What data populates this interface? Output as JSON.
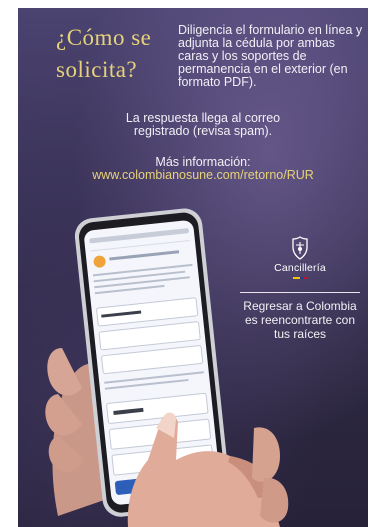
{
  "headline": {
    "line1": "¿Cómo se",
    "line2": "solicita?"
  },
  "intro_text": "Diligencia el formulario en línea y adjunta la cédula por ambas caras y los soportes de permanencia en el exterior (en formato PDF).",
  "response_text": "La respuesta llega al correo registrado (revisa spam).",
  "more_info": {
    "label": "Más información:",
    "url": "www.colombianosune.com/retorno/RUR"
  },
  "brand": {
    "name": "Cancillería",
    "icon": "coat-of-arms-icon"
  },
  "tagline": "Regresar a Colombia es reencontrarte con tus raíces",
  "colors": {
    "background": "#3a3358",
    "accent_gold": "#e7d27a",
    "text": "#f2f0f6"
  }
}
